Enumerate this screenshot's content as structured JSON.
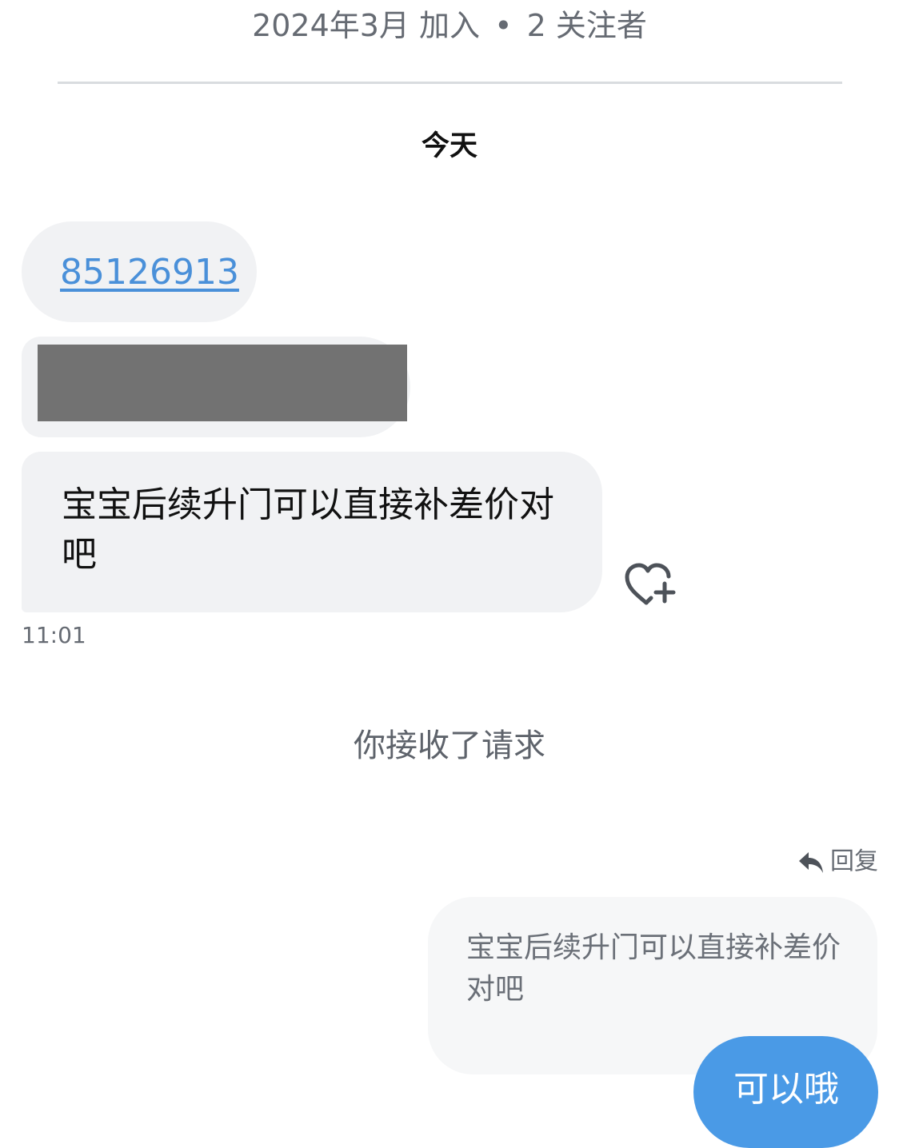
{
  "profile": {
    "joined": "2024年3月 加入",
    "separator": "•",
    "followers": "2 关注者"
  },
  "day_label": "今天",
  "incoming": {
    "phone_link": "85126913",
    "redacted_message": "",
    "question": "宝宝后续升门可以直接补差价对吧",
    "time": "11:01"
  },
  "system_notice": "你接收了请求",
  "reply": {
    "label": "回复",
    "quoted_text": "宝宝后续升门可以直接补差价对吧",
    "message": "可以哦"
  },
  "icons": {
    "react": "heart-plus-icon",
    "reply": "reply-arrow-icon"
  },
  "colors": {
    "incoming_bubble": "#f1f2f4",
    "quoted_bubble": "#f6f7f8",
    "outgoing_bubble": "#4a9ae6",
    "link": "#4a90d9",
    "redaction": "#727272",
    "muted_text": "#666b73"
  }
}
